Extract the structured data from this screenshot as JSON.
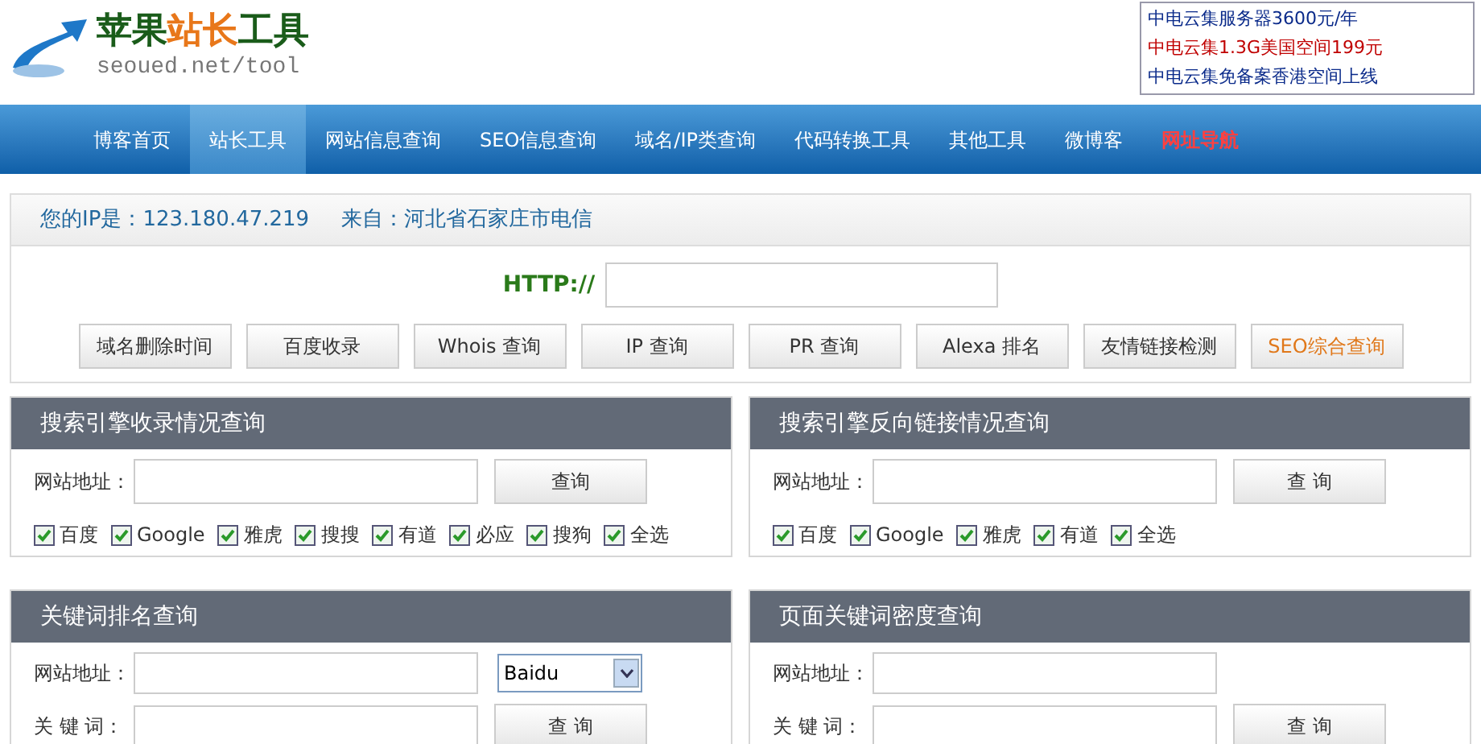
{
  "logo": {
    "title_parts": [
      {
        "text": "苹果",
        "color": "#1a5c1a"
      },
      {
        "text": "站长",
        "color": "#e8771a"
      },
      {
        "text": "工具",
        "color": "#1a5c1a"
      }
    ],
    "subtitle": "seoued.net/tool"
  },
  "ads": [
    {
      "text": "中电云集服务器3600元/年",
      "color": "#0a2a8a"
    },
    {
      "text": "中电云集1.3G美国空间199元",
      "color": "#c00000"
    },
    {
      "text": "中电云集免备案香港空间上线",
      "color": "#0a2a8a"
    }
  ],
  "nav": [
    {
      "label": "博客首页",
      "selected": false,
      "highlighted": false
    },
    {
      "label": "站长工具",
      "selected": true,
      "highlighted": false
    },
    {
      "label": "网站信息查询",
      "selected": false,
      "highlighted": false
    },
    {
      "label": "SEO信息查询",
      "selected": false,
      "highlighted": false
    },
    {
      "label": "域名/IP类查询",
      "selected": false,
      "highlighted": false
    },
    {
      "label": "代码转换工具",
      "selected": false,
      "highlighted": false
    },
    {
      "label": "其他工具",
      "selected": false,
      "highlighted": false
    },
    {
      "label": "微博客",
      "selected": false,
      "highlighted": false
    },
    {
      "label": "网址导航",
      "selected": false,
      "highlighted": true
    }
  ],
  "ip_panel": {
    "ip_label": "您的IP是：",
    "ip": "123.180.47.219",
    "from_label": "来自：",
    "from": "河北省石家庄市电信",
    "http_label": "HTTP://",
    "buttons": [
      {
        "label": "域名删除时间",
        "highlighted": false
      },
      {
        "label": "百度收录",
        "highlighted": false
      },
      {
        "label": "Whois 查询",
        "highlighted": false
      },
      {
        "label": "IP 查询",
        "highlighted": false
      },
      {
        "label": "PR 查询",
        "highlighted": false
      },
      {
        "label": "Alexa 排名",
        "highlighted": false
      },
      {
        "label": "友情链接检测",
        "highlighted": false
      },
      {
        "label": "SEO综合查询",
        "highlighted": true
      }
    ]
  },
  "panels": [
    {
      "title": "搜索引擎收录情况查询",
      "fields": [
        {
          "label": "网站地址："
        }
      ],
      "button": "查询",
      "checks": [
        {
          "label": "百度",
          "checked": true
        },
        {
          "label": "Google",
          "checked": true
        },
        {
          "label": "雅虎",
          "checked": true
        },
        {
          "label": "搜搜",
          "checked": true
        },
        {
          "label": "有道",
          "checked": true
        },
        {
          "label": "必应",
          "checked": true
        },
        {
          "label": "搜狗",
          "checked": true
        },
        {
          "label": "全选",
          "checked": true
        }
      ]
    },
    {
      "title": "搜索引擎反向链接情况查询",
      "fields": [
        {
          "label": "网站地址："
        }
      ],
      "button": "查 询",
      "checks": [
        {
          "label": "百度",
          "checked": true
        },
        {
          "label": "Google",
          "checked": true
        },
        {
          "label": "雅虎",
          "checked": true
        },
        {
          "label": "有道",
          "checked": true
        },
        {
          "label": "全选",
          "checked": true
        }
      ]
    },
    {
      "title": "关键词排名查询",
      "fields": [
        {
          "label": "网站地址："
        },
        {
          "label": "关 键 词："
        }
      ],
      "button": "查 询",
      "select": "Baidu"
    },
    {
      "title": "页面关键词密度查询",
      "fields": [
        {
          "label": "网站地址："
        },
        {
          "label": "关 键 词："
        }
      ],
      "button": "查 询"
    }
  ]
}
